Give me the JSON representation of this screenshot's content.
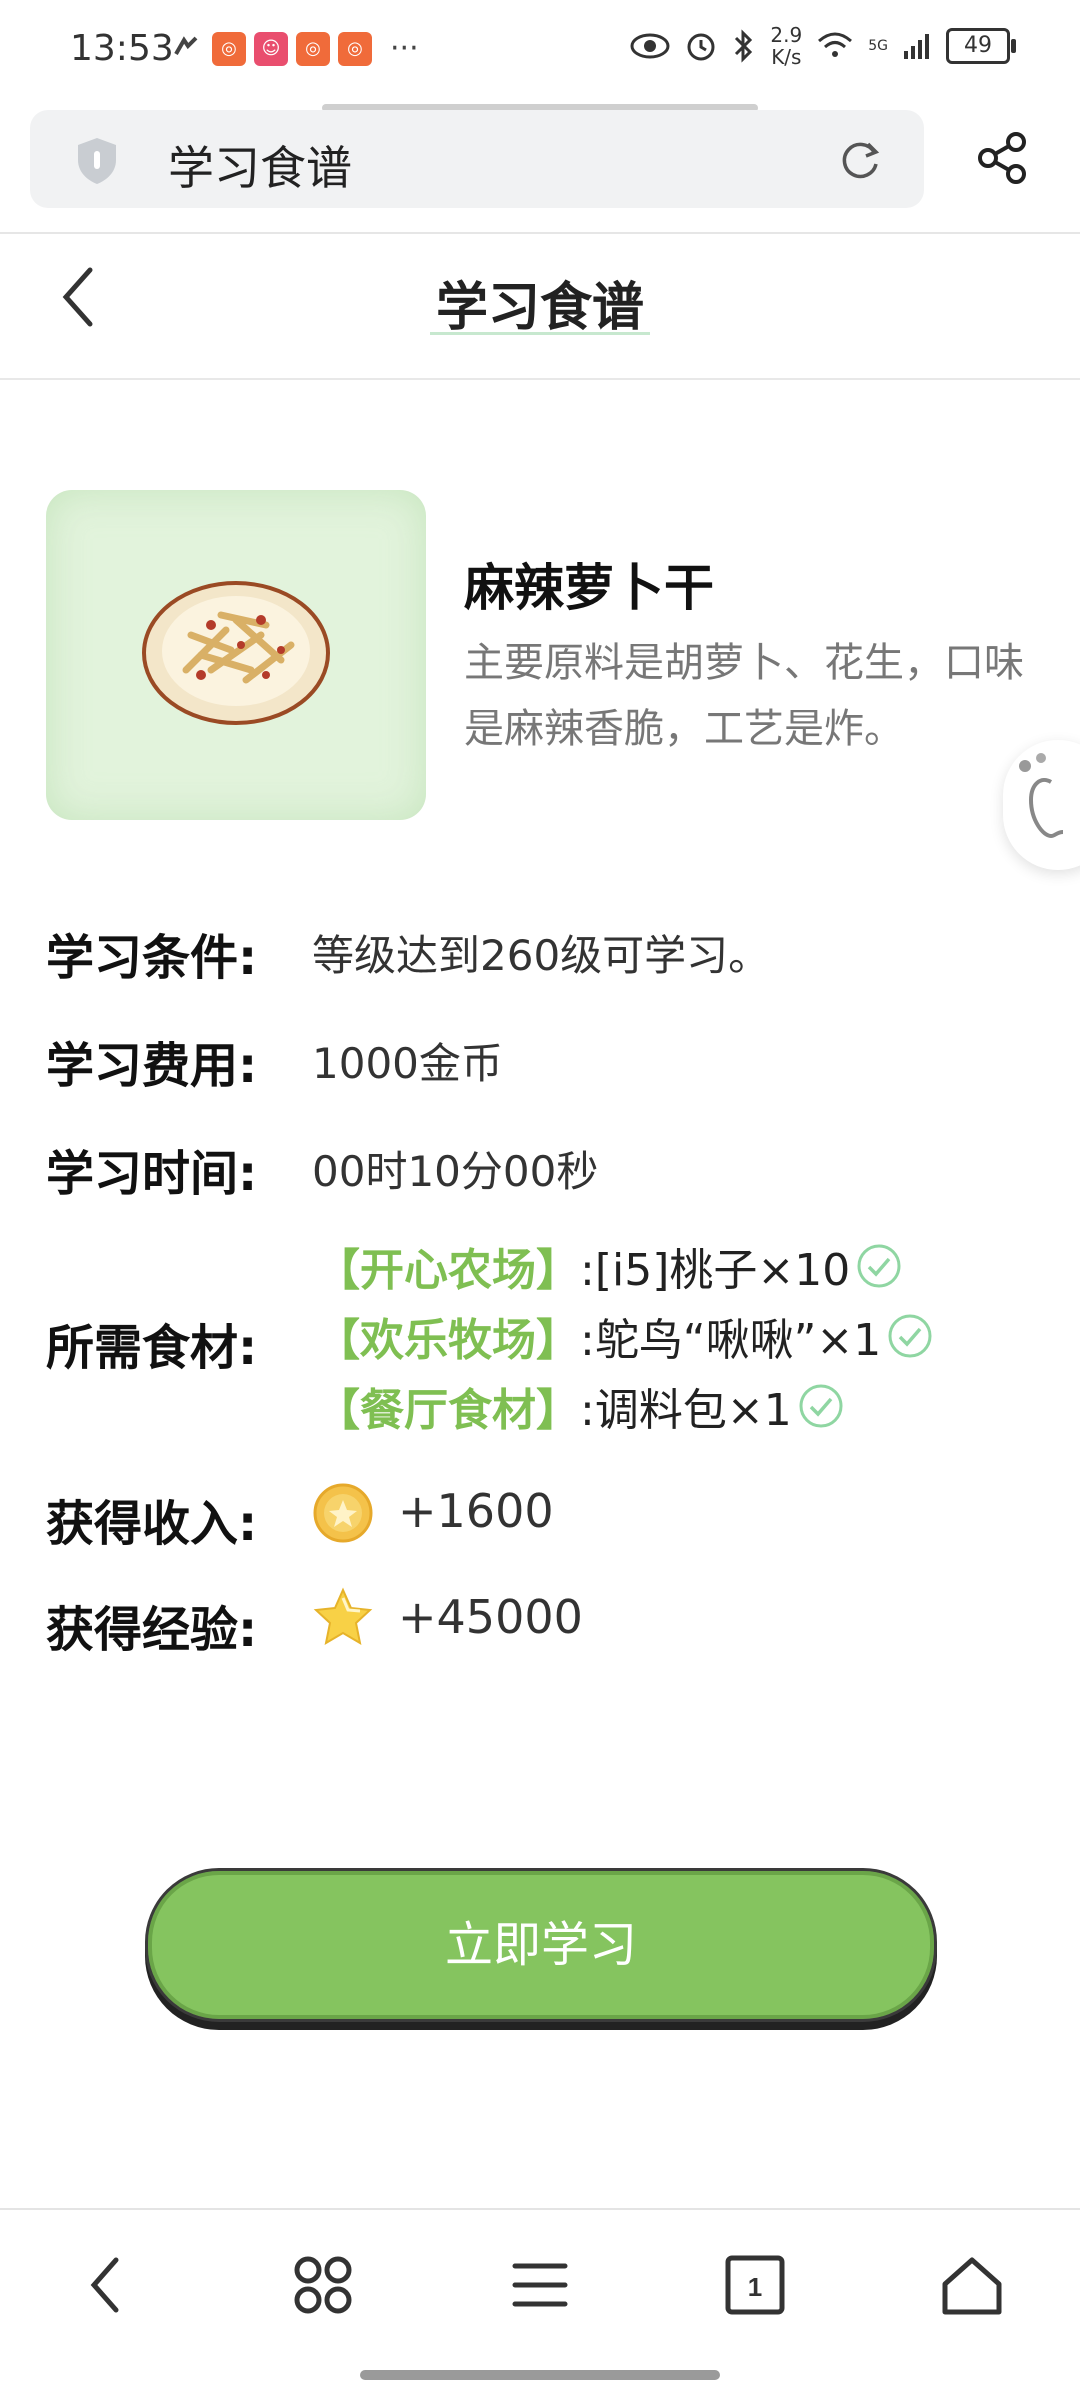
{
  "status_bar": {
    "time": "13:53",
    "net_speed_value": "2.9",
    "net_speed_unit": "K/s",
    "network": "5G",
    "battery": "49"
  },
  "browser": {
    "address_text": "学习食谱"
  },
  "header": {
    "title": "学习食谱"
  },
  "recipe": {
    "name": "麻辣萝卜干",
    "description": "主要原料是胡萝卜、花生，口味是麻辣香脆，工艺是炸。"
  },
  "info": {
    "condition_label": "学习条件:",
    "condition_value": "等级达到260级可学习。",
    "cost_label": "学习费用:",
    "cost_value": "1000金币",
    "time_label": "学习时间:",
    "time_value": "00时10分00秒",
    "ingredients_label": "所需食材:",
    "ingredients": [
      {
        "tag": "【开心农场】",
        "text": ":[i5]桃子×10"
      },
      {
        "tag": "【欢乐牧场】",
        "text": ":鸵鸟“啾啾”×1"
      },
      {
        "tag": "【餐厅食材】",
        "text": ":调料包×1"
      }
    ],
    "income_label": "获得收入:",
    "income_value": "+1600",
    "exp_label": "获得经验:",
    "exp_value": "+45000"
  },
  "actions": {
    "learn_button": "立即学习"
  },
  "colors": {
    "accent_green": "#85c45f",
    "tag_green": "#7fbf52",
    "thumb_bg": "#e2f3dc"
  }
}
